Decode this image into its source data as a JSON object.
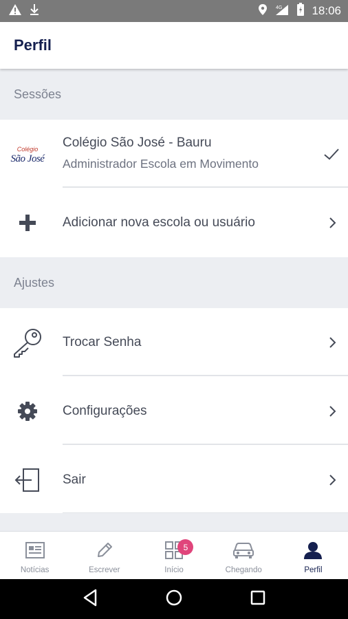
{
  "status_bar": {
    "time": "18:06",
    "icons": [
      "warning-icon",
      "download-icon",
      "location-icon",
      "signal-4g-icon",
      "battery-icon"
    ]
  },
  "app_bar": {
    "title": "Perfil"
  },
  "sections": {
    "sessions": {
      "title": "Sessões"
    },
    "settings": {
      "title": "Ajustes"
    }
  },
  "school": {
    "logo_top": "Colégio",
    "logo_name": "São José",
    "name": "Colégio São José - Bauru",
    "role": "Administrador Escola em Movimento",
    "selected": true
  },
  "add_school": {
    "label": "Adicionar nova escola ou usuário",
    "icon": "plus-icon"
  },
  "settings_items": [
    {
      "label": "Trocar Senha",
      "icon": "key-icon"
    },
    {
      "label": "Configurações",
      "icon": "gear-icon"
    },
    {
      "label": "Sair",
      "icon": "logout-icon"
    }
  ],
  "bottom_nav": [
    {
      "label": "Notícias",
      "icon": "news-icon"
    },
    {
      "label": "Escrever",
      "icon": "pencil-icon"
    },
    {
      "label": "Início",
      "icon": "grid-icon",
      "badge": "5"
    },
    {
      "label": "Chegando",
      "icon": "car-icon"
    },
    {
      "label": "Perfil",
      "icon": "person-icon",
      "active": true
    }
  ],
  "colors": {
    "primary": "#15204f",
    "badge": "#e0457b",
    "section_bg": "#eceef2",
    "status_bar": "#7a7a7a"
  }
}
